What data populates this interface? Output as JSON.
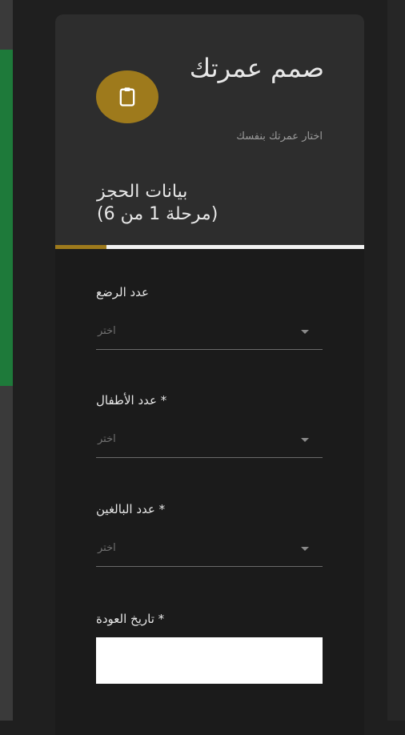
{
  "header": {
    "title": "صمم عمرتك",
    "subtitle": "اختار عمرتك بنفسك",
    "step_title": "بيانات الحجز",
    "step_progress": "(مرحلة 1 من 6)",
    "progress_fraction": 0.167,
    "badge_icon": "clipboard-icon",
    "accent_color": "#9e7a1c"
  },
  "form": {
    "infants": {
      "label": "عدد الرضع",
      "value": "اختر"
    },
    "children": {
      "label": "* عدد الأطفال",
      "value": "اختر"
    },
    "adults": {
      "label": "* عدد البالغين",
      "value": "اختر"
    },
    "return_date": {
      "label": "* تاريخ العودة",
      "value": ""
    }
  }
}
